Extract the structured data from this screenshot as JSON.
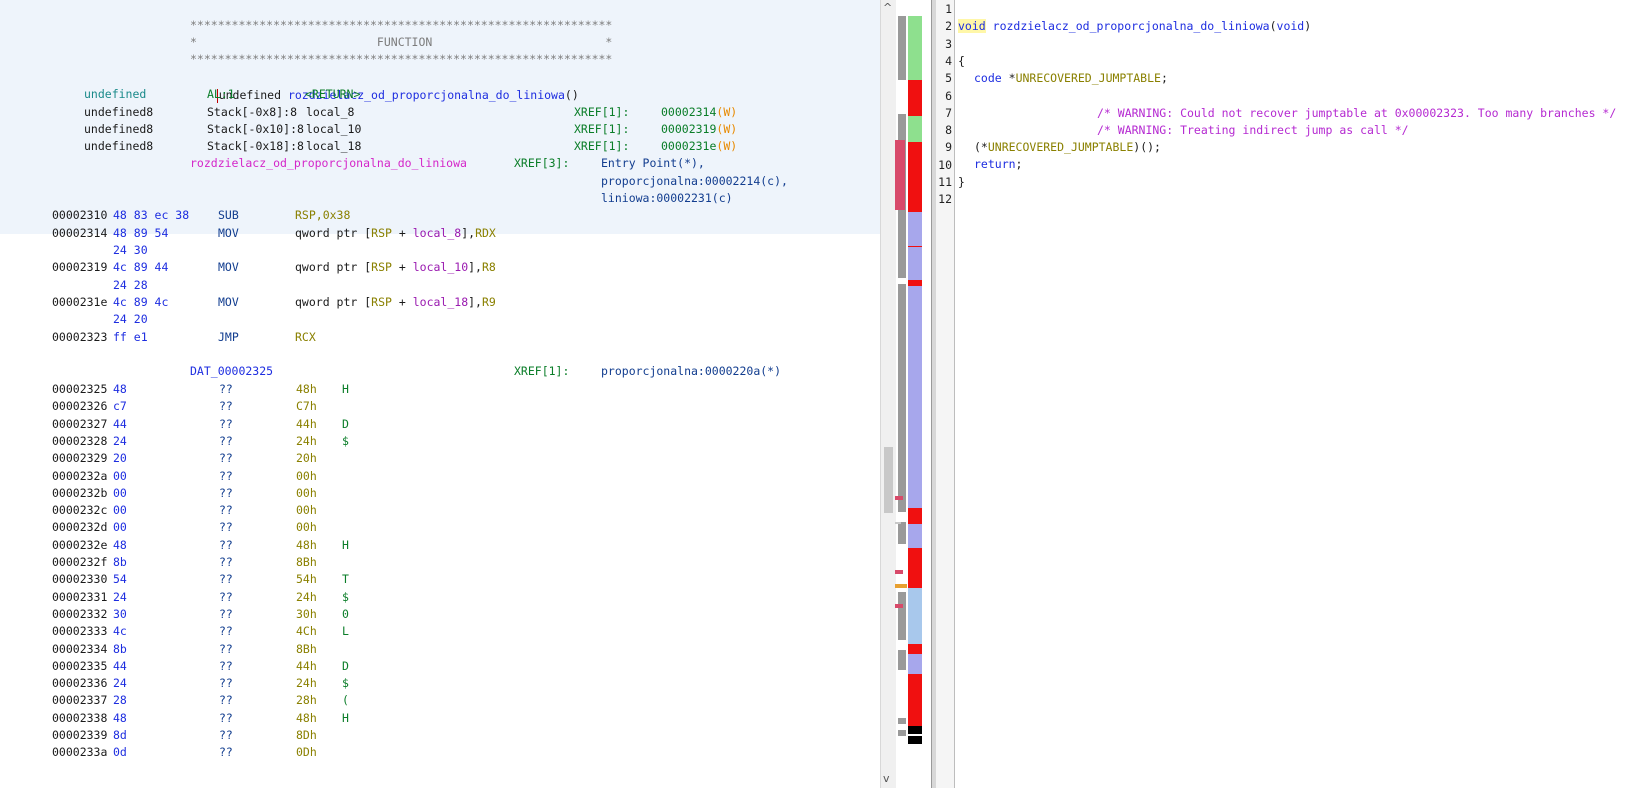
{
  "listing": {
    "header": {
      "stars": "*************************************************************",
      "func_label": "*                          FUNCTION                         *",
      "signature_type": "undefined",
      "signature_name": "rozdzielacz_od_proporcjonalna_do_liniowa",
      "signature_parens": "()",
      "return_type": "undefined",
      "return_reg": "AL:1",
      "return_label": "<RETURN>",
      "vars": [
        {
          "type": "undefined8",
          "loc": "Stack[-0x8]:8",
          "name": "local_8",
          "xref": "XREF[1]:",
          "addr": "00002314",
          "mode": "(W)"
        },
        {
          "type": "undefined8",
          "loc": "Stack[-0x10]:8",
          "name": "local_10",
          "xref": "XREF[1]:",
          "addr": "00002319",
          "mode": "(W)"
        },
        {
          "type": "undefined8",
          "loc": "Stack[-0x18]:8",
          "name": "local_18",
          "xref": "XREF[1]:",
          "addr": "0000231e",
          "mode": "(W)"
        }
      ],
      "entry_label": "rozdzielacz_od_proporcjonalna_do_liniowa",
      "entry_xref": "XREF[3]:",
      "entry_refs": [
        "Entry Point(*),",
        "proporcjonalna:00002214(c),",
        "liniowa:00002231(c)"
      ]
    },
    "instructions": [
      {
        "addr": "00002310",
        "bytes": "48 83 ec 38",
        "mnem": "SUB",
        "ops": "RSP,0x38"
      },
      {
        "addr": "00002314",
        "bytes": "48 89 54",
        "bytes2": "24 30",
        "mnem": "MOV",
        "ops_a": "qword ptr [",
        "reg": "RSP",
        "plus": " + ",
        "var": "local_8",
        "ops_b": "],",
        "src": "RDX"
      },
      {
        "addr": "00002319",
        "bytes": "4c 89 44",
        "bytes2": "24 28",
        "mnem": "MOV",
        "ops_a": "qword ptr [",
        "reg": "RSP",
        "plus": " + ",
        "var": "local_10",
        "ops_b": "],",
        "src": "R8"
      },
      {
        "addr": "0000231e",
        "bytes": "4c 89 4c",
        "bytes2": "24 20",
        "mnem": "MOV",
        "ops_a": "qword ptr [",
        "reg": "RSP",
        "plus": " + ",
        "var": "local_18",
        "ops_b": "],",
        "src": "R9"
      },
      {
        "addr": "00002323",
        "bytes": "ff e1",
        "mnem": "JMP",
        "ops": "RCX"
      }
    ],
    "dat_label": "DAT_00002325",
    "dat_xref": "XREF[1]:",
    "dat_ref": "proporcjonalna:0000220a(*)",
    "data_rows": [
      {
        "addr": "00002325",
        "byte": "48",
        "q": "??",
        "val": "48h",
        "chr": "H"
      },
      {
        "addr": "00002326",
        "byte": "c7",
        "q": "??",
        "val": "C7h",
        "chr": ""
      },
      {
        "addr": "00002327",
        "byte": "44",
        "q": "??",
        "val": "44h",
        "chr": "D"
      },
      {
        "addr": "00002328",
        "byte": "24",
        "q": "??",
        "val": "24h",
        "chr": "$"
      },
      {
        "addr": "00002329",
        "byte": "20",
        "q": "??",
        "val": "20h",
        "chr": ""
      },
      {
        "addr": "0000232a",
        "byte": "00",
        "q": "??",
        "val": "00h",
        "chr": ""
      },
      {
        "addr": "0000232b",
        "byte": "00",
        "q": "??",
        "val": "00h",
        "chr": ""
      },
      {
        "addr": "0000232c",
        "byte": "00",
        "q": "??",
        "val": "00h",
        "chr": ""
      },
      {
        "addr": "0000232d",
        "byte": "00",
        "q": "??",
        "val": "00h",
        "chr": ""
      },
      {
        "addr": "0000232e",
        "byte": "48",
        "q": "??",
        "val": "48h",
        "chr": "H"
      },
      {
        "addr": "0000232f",
        "byte": "8b",
        "q": "??",
        "val": "8Bh",
        "chr": ""
      },
      {
        "addr": "00002330",
        "byte": "54",
        "q": "??",
        "val": "54h",
        "chr": "T"
      },
      {
        "addr": "00002331",
        "byte": "24",
        "q": "??",
        "val": "24h",
        "chr": "$"
      },
      {
        "addr": "00002332",
        "byte": "30",
        "q": "??",
        "val": "30h",
        "chr": "0"
      },
      {
        "addr": "00002333",
        "byte": "4c",
        "q": "??",
        "val": "4Ch",
        "chr": "L"
      },
      {
        "addr": "00002334",
        "byte": "8b",
        "q": "??",
        "val": "8Bh",
        "chr": ""
      },
      {
        "addr": "00002335",
        "byte": "44",
        "q": "??",
        "val": "44h",
        "chr": "D"
      },
      {
        "addr": "00002336",
        "byte": "24",
        "q": "??",
        "val": "24h",
        "chr": "$"
      },
      {
        "addr": "00002337",
        "byte": "28",
        "q": "??",
        "val": "28h",
        "chr": "("
      },
      {
        "addr": "00002338",
        "byte": "48",
        "q": "??",
        "val": "48h",
        "chr": "H"
      },
      {
        "addr": "00002339",
        "byte": "8d",
        "q": "??",
        "val": "8Dh",
        "chr": ""
      },
      {
        "addr": "0000233a",
        "byte": "0d",
        "q": "??",
        "val": "0Dh",
        "chr": ""
      }
    ]
  },
  "scrollbar": {
    "up_icon": "chevron-up-icon",
    "down_icon": "chevron-down-icon",
    "up_glyph": "^",
    "down_glyph": "v"
  },
  "colors": {
    "header_bg": "#eef4fb",
    "overview_red": "#f01010",
    "overview_green": "#8ee08e",
    "overview_purple": "#a7a7ec",
    "overview_lightblue": "#a8c8ec",
    "overview_black": "#000000"
  },
  "decompiler": {
    "line_numbers": [
      "1",
      "2",
      "3",
      "4",
      "5",
      "6",
      "7",
      "8",
      "9",
      "10",
      "11",
      "12"
    ],
    "l2_kw": "void",
    "l2_fn": "rozdzielacz_od_proporcjonalna_do_liniowa",
    "l2_paren_open": "(",
    "l2_arg": "void",
    "l2_paren_close": ")",
    "l4": "{",
    "l5_type": "code",
    "l5_star": " *",
    "l5_glob": "UNRECOVERED_JUMPTABLE",
    "l5_semi": ";",
    "l7": "/* WARNING: Could not recover jumptable at 0x00002323. Too many branches */",
    "l8": "/* WARNING: Treating indirect jump as call */",
    "l9_open": "(*",
    "l9_glob": "UNRECOVERED_JUMPTABLE",
    "l9_close": ")();",
    "l10_kw": "return",
    "l10_semi": ";",
    "l11": "}"
  }
}
